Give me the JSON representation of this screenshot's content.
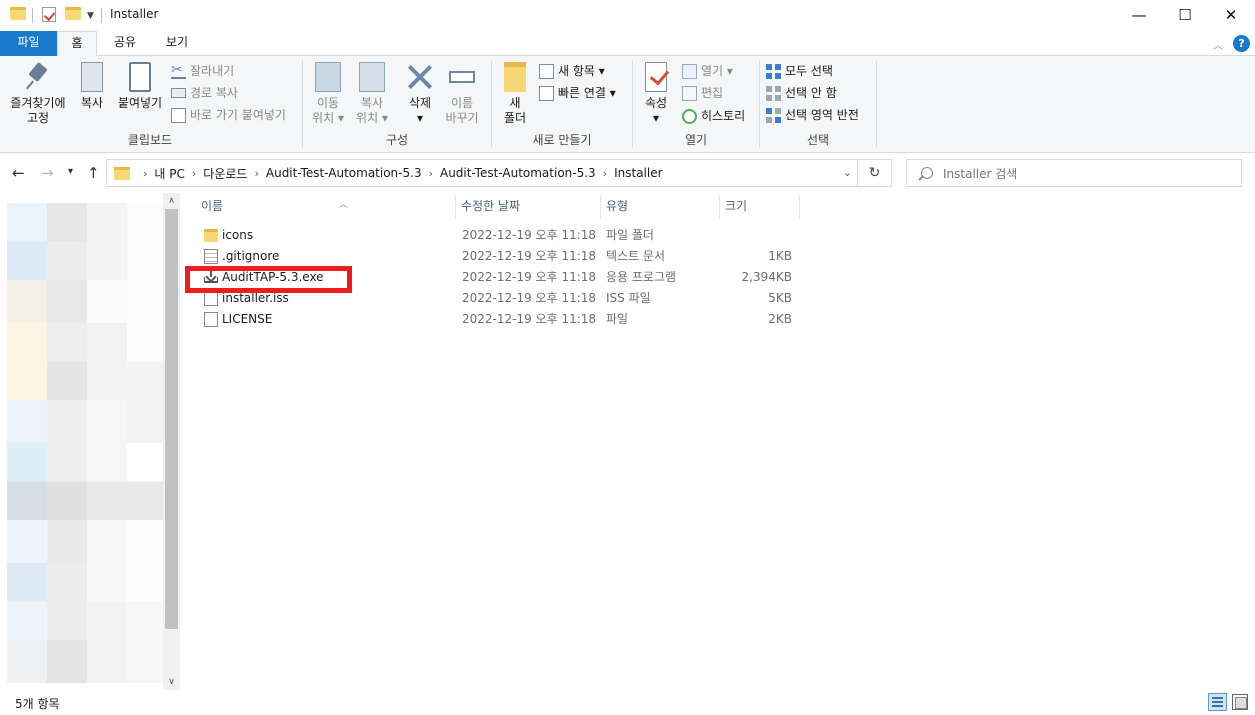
{
  "window": {
    "title": "Installer",
    "minimize": "—",
    "maximize": "☐",
    "close": "✕"
  },
  "ribbon_tabs": {
    "file": "파일",
    "home": "홈",
    "share": "공유",
    "view": "보기"
  },
  "ribbon": {
    "clipboard": {
      "label": "클립보드",
      "pin": "즐겨찾기에\n고정",
      "copy": "복사",
      "paste": "붙여넣기",
      "cut": "잘라내기",
      "copy_path": "경로 복사",
      "paste_shortcut": "바로 가기 붙여넣기"
    },
    "organize": {
      "label": "구성",
      "move_to_1": "이동",
      "move_to_2": "위치",
      "copy_to_1": "복사",
      "copy_to_2": "위치",
      "delete": "삭제",
      "rename_1": "이름",
      "rename_2": "바꾸기"
    },
    "new": {
      "label": "새로 만들기",
      "new_folder_1": "새",
      "new_folder_2": "폴더",
      "new_item": "새 항목",
      "easy_access": "빠른 연결"
    },
    "open": {
      "label": "열기",
      "properties": "속성",
      "open": "열기",
      "edit": "편집",
      "history": "히스토리"
    },
    "select": {
      "label": "선택",
      "select_all": "모두 선택",
      "select_none": "선택 안 함",
      "invert": "선택 영역 반전"
    }
  },
  "address_bar": {
    "crumbs": [
      "내 PC",
      "다운로드",
      "Audit-Test-Automation-5.3",
      "Audit-Test-Automation-5.3",
      "Installer"
    ],
    "search_placeholder": "Installer 검색"
  },
  "columns": {
    "name": "이름",
    "modified": "수정한 날짜",
    "type": "유형",
    "size": "크기"
  },
  "files": [
    {
      "name": "icons",
      "modified": "2022-12-19 오후 11:18",
      "type": "파일 폴더",
      "size": "",
      "icon": "folder-icon"
    },
    {
      "name": ".gitignore",
      "modified": "2022-12-19 오후 11:18",
      "type": "텍스트 문서",
      "size": "1KB",
      "icon": "text-file-icon"
    },
    {
      "name": "AuditTAP-5.3.exe",
      "modified": "2022-12-19 오후 11:18",
      "type": "응용 프로그램",
      "size": "2,394KB",
      "icon": "installer-icon"
    },
    {
      "name": "installer.iss",
      "modified": "2022-12-19 오후 11:18",
      "type": "ISS 파일",
      "size": "5KB",
      "icon": "file-icon"
    },
    {
      "name": "LICENSE",
      "modified": "2022-12-19 오후 11:18",
      "type": "파일",
      "size": "2KB",
      "icon": "file-icon"
    }
  ],
  "status": {
    "item_count": "5개 항목"
  },
  "colors": {
    "accent": "#1979ca",
    "highlight": "#ee1c1c"
  }
}
